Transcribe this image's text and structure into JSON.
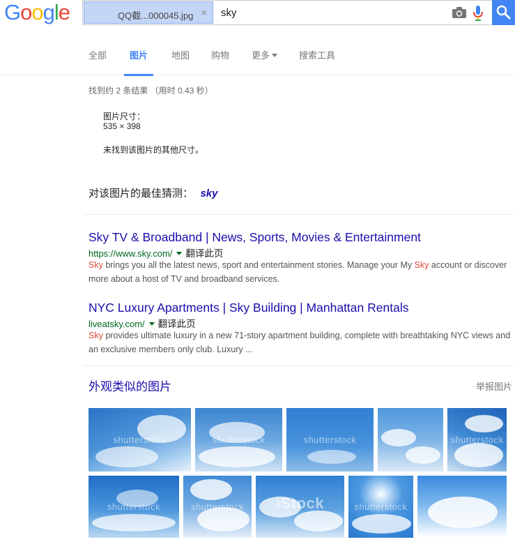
{
  "header": {
    "logo": [
      "G",
      "o",
      "o",
      "g",
      "l",
      "e"
    ],
    "logo_colors": [
      "#4285f4",
      "#ea4335",
      "#fbbc05",
      "#4285f4",
      "#34a853",
      "#ea4335"
    ],
    "image_chip_name": "QQ截...000045.jpg",
    "chip_close": "×",
    "query": "sky"
  },
  "tabs": [
    {
      "label": "全部",
      "active": false
    },
    {
      "label": "图片",
      "active": true
    },
    {
      "label": "地图",
      "active": false
    },
    {
      "label": "购物",
      "active": false
    },
    {
      "label": "更多",
      "active": false
    },
    {
      "label": "搜索工具",
      "active": false
    }
  ],
  "results_stats": "找到约 2 条结果 （用时 0.43 秒）",
  "image_info": {
    "size_label": "图片尺寸：",
    "size_value": "535 × 398",
    "no_other": "未找到该图片的其他尺寸。"
  },
  "best_guess": {
    "label": "对该图片的最佳猜测：",
    "query": "sky"
  },
  "results": [
    {
      "title": "Sky TV & Broadband | News, Sports, Movies & Entertainment",
      "url": "https://www.sky.com/",
      "translate": "翻译此页",
      "snippet_hl1": "Sky",
      "snippet_1": " brings you all the latest news, sport and entertainment stories. Manage your My ",
      "snippet_hl2": "Sky",
      "snippet_2": " account or discover more about a host of TV and broadband services."
    },
    {
      "title": "NYC Luxury Apartments | Sky Building | Manhattan Rentals",
      "url": "liveatsky.com/",
      "translate": "翻译此页",
      "snippet_hl1": "Sky",
      "snippet_1": " provides ultimate luxury in a new 71-story apartment building, complete with breathtaking NYC views and an exclusive members only club. Luxury ..."
    }
  ],
  "similar": {
    "title": "外观类似的图片",
    "report": "举报图片",
    "thumbnails": [
      {
        "watermark": "shutterstock"
      },
      {
        "watermark": "shutterstock"
      },
      {
        "watermark": "shutterstock"
      },
      {
        "watermark": ""
      },
      {
        "watermark": "shutterstock"
      },
      {
        "watermark": "shutterstock"
      },
      {
        "watermark": "shutterstock"
      },
      {
        "watermark": "iStock"
      },
      {
        "watermark": "shutterstock"
      },
      {
        "watermark": ""
      }
    ]
  },
  "colors": {
    "search_blue": "#4285f4",
    "link_blue": "#1a0dab",
    "url_green": "#006621",
    "highlight_red": "#dd4b39"
  },
  "icons": [
    "camera-icon",
    "mic-icon",
    "search-icon",
    "dropdown-triangle-icon"
  ]
}
